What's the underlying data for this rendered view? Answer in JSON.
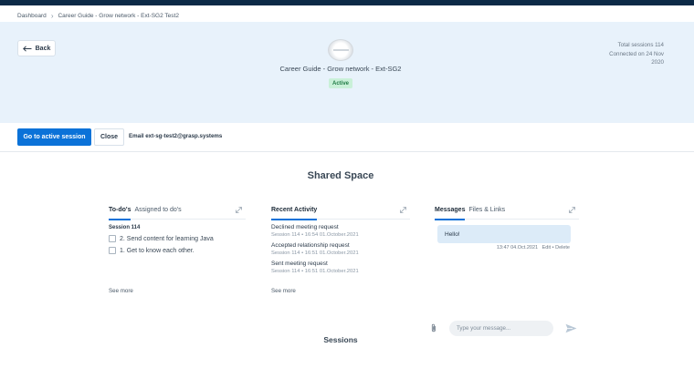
{
  "breadcrumb": {
    "root": "Dashboard",
    "current": "Career Guide - Grow network - Ext-SG2 Test2"
  },
  "header": {
    "back_label": "Back",
    "session_title": "Career Guide - Grow network - Ext-SG2",
    "status": "Active",
    "meta_line1": "Total sessions 114",
    "meta_line2": "Connected on 24 Nov",
    "meta_line3": "2020"
  },
  "actions": {
    "go_active_label": "Go to active session",
    "close_label": "Close",
    "email_label": "Email ext-sg-test2@grasp.systems"
  },
  "shared_space": {
    "title": "Shared Space",
    "todos": {
      "tab_active": "To-do's",
      "tab_other": "Assigned to do's",
      "session_label": "Session 114",
      "items": [
        "2. Send content for learning Java",
        "1. Get to know each other."
      ],
      "see_more": "See more"
    },
    "activity": {
      "tab_active": "Recent Activity",
      "items": [
        {
          "title": "Declined meeting request",
          "meta": "Session 114 • 16:54 01.October.2021"
        },
        {
          "title": "Accepted relationship request",
          "meta": "Session 114 • 16:51 01.October.2021"
        },
        {
          "title": "Sent meeting request",
          "meta": "Session 114 • 16:51 01.October.2021"
        }
      ],
      "see_more": "See more"
    },
    "messages": {
      "tab_active": "Messages",
      "tab_other": "Files & Links",
      "bubble_text": "Hello!",
      "time": "13:47 04.Oct.2021",
      "edit": "Edit",
      "delete": "Delete",
      "input_placeholder": "Type your message..."
    }
  },
  "sessions": {
    "title": "Sessions"
  },
  "colors": {
    "primary": "#0b72d8",
    "hero_bg": "#e8f2fb",
    "topbar": "#0c2a47",
    "badge_bg": "#c9f0d8",
    "badge_text": "#1f7a45"
  },
  "icons": {
    "back": "arrow-left-icon",
    "expand": "expand-icon",
    "attach": "paperclip-icon",
    "send": "send-icon"
  }
}
